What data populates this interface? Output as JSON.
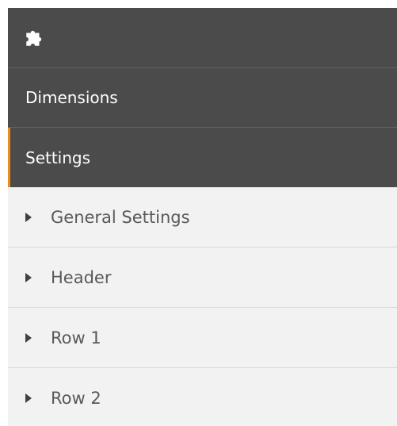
{
  "toolbar": {
    "icon": "puzzle-piece-icon",
    "icon_color": "#ffffff",
    "background": "#4b4b4b"
  },
  "sections": {
    "dimensions_label": "Dimensions",
    "settings_label": "Settings",
    "active": "Settings",
    "accent_color": "#f18a1c"
  },
  "accordion": {
    "items": [
      {
        "label": "General Settings",
        "icon": "caret-right-icon"
      },
      {
        "label": "Header",
        "icon": "caret-right-icon"
      },
      {
        "label": "Row 1",
        "icon": "caret-right-icon"
      },
      {
        "label": "Row 2",
        "icon": "caret-right-icon"
      }
    ]
  }
}
